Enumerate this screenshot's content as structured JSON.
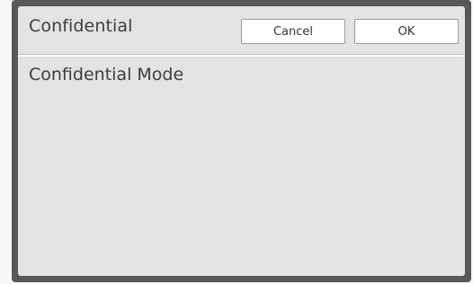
{
  "dialog": {
    "title": "Confidential",
    "cancel_label": "Cancel",
    "ok_label": "OK"
  },
  "content": {
    "setting_label": "Confidential Mode"
  }
}
